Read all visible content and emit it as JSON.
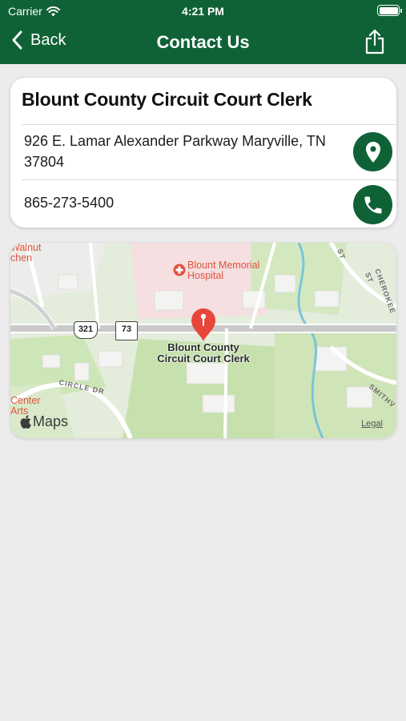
{
  "status_bar": {
    "carrier": "Carrier",
    "time": "4:21 PM"
  },
  "nav": {
    "back_label": "Back",
    "title": "Contact Us"
  },
  "contact": {
    "name": "Blount County Circuit Court Clerk",
    "address": "926 E. Lamar Alexander Parkway Maryville, TN 37804",
    "phone": "865-273-5400"
  },
  "map": {
    "pin_label_line1": "Blount County",
    "pin_label_line2": "Circuit Court Clerk",
    "poi_hospital_line1": "Blount Memorial",
    "poi_hospital_line2": "Hospital",
    "poi_walnut_line1": "Walnut",
    "poi_walnut_line2": "chen",
    "poi_center_line1": "Center",
    "poi_center_line2": "Arts",
    "street_circle": "CIRCLE DR",
    "street_cherokee": "CHEROKEE ST",
    "street_smith": "SMITHV",
    "street_st": "ST",
    "route_321": "321",
    "route_73": "73",
    "maps_brand": "Maps",
    "legal": "Legal"
  },
  "colors": {
    "brand_green": "#0f6236",
    "pin_red": "#e8453c",
    "poi_red": "#e0533f"
  },
  "icons": [
    "wifi-icon",
    "battery-icon",
    "back-chevron-icon",
    "share-icon",
    "location-pin-icon",
    "phone-icon",
    "map-pin-icon",
    "hospital-icon",
    "apple-logo-icon"
  ]
}
